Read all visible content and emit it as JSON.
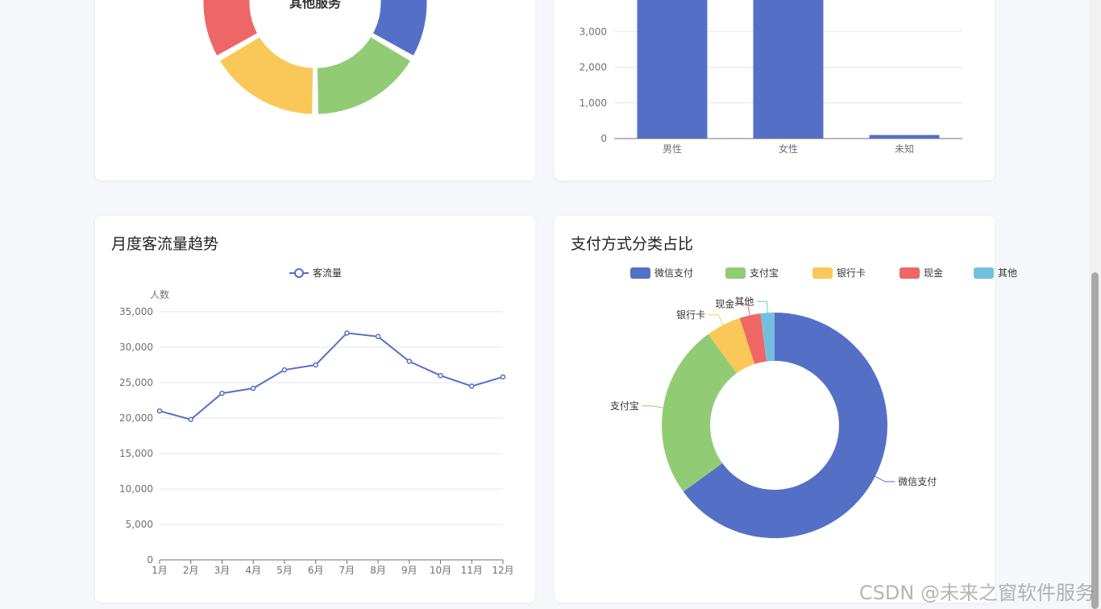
{
  "top_left": {
    "center_label": "其他服务",
    "colors": [
      "#5470c6",
      "#91cc75",
      "#fac858",
      "#ee6666"
    ]
  },
  "top_right": {
    "chart_data": {
      "type": "bar",
      "categories": [
        "男性",
        "女性",
        "未知"
      ],
      "values": [
        4000,
        4000,
        100
      ],
      "ylim": [
        0,
        4000
      ],
      "yticks": [
        0,
        1000,
        2000,
        3000
      ],
      "ytick_labels": [
        "0",
        "1,000",
        "2,000",
        "3,000"
      ],
      "color": "#5470c6"
    }
  },
  "line_panel": {
    "title": "月度客流量趋势",
    "legend": "客流量",
    "chart_data": {
      "type": "line",
      "categories": [
        "1月",
        "2月",
        "3月",
        "4月",
        "5月",
        "6月",
        "7月",
        "8月",
        "9月",
        "10月",
        "11月",
        "12月"
      ],
      "series": [
        {
          "name": "客流量",
          "values": [
            21000,
            19800,
            23500,
            24200,
            26800,
            27500,
            32000,
            31500,
            28000,
            26000,
            24500,
            25800
          ]
        }
      ],
      "ylabel": "人数",
      "ylim": [
        0,
        35000
      ],
      "yticks": [
        0,
        5000,
        10000,
        15000,
        20000,
        25000,
        30000,
        35000
      ],
      "ytick_labels": [
        "0",
        "5,000",
        "10,000",
        "15,000",
        "20,000",
        "25,000",
        "30,000",
        "35,000"
      ],
      "color": "#5470c6"
    }
  },
  "pie_panel": {
    "title": "支付方式分类占比",
    "chart_data": {
      "type": "pie",
      "categories": [
        "微信支付",
        "支付宝",
        "银行卡",
        "现金",
        "其他"
      ],
      "values": [
        65,
        25,
        5,
        3,
        2
      ],
      "colors": [
        "#5470c6",
        "#91cc75",
        "#fac858",
        "#ee6666",
        "#73c0de"
      ]
    }
  },
  "watermark": "CSDN @未来之窗软件服务"
}
